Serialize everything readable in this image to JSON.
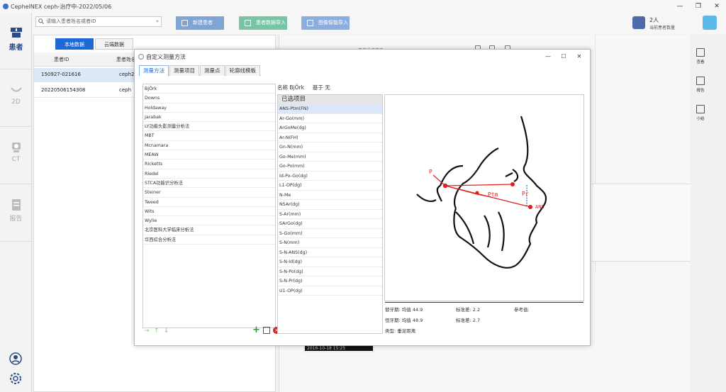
{
  "window": {
    "title": "CephelNEX  ceph-治疗中-2022/05/06",
    "minimize": "—",
    "restore": "❐",
    "close": "✕"
  },
  "nav": {
    "items": [
      {
        "label": "患者",
        "icon": "patient-icon"
      },
      {
        "label": "2D",
        "icon": "smile-icon"
      },
      {
        "label": "CT",
        "icon": "ct-icon"
      },
      {
        "label": "报告",
        "icon": "report-icon"
      }
    ],
    "bottom": [
      {
        "icon": "user-icon"
      },
      {
        "icon": "settings-icon"
      }
    ]
  },
  "toolbar": {
    "search_placeholder": "请输入患者姓名或者ID",
    "new_patient": "新建患者",
    "import_data": "患者数据导入",
    "smart_import": "图像智能导入",
    "patients_count": "2人",
    "patients_caption": "当前患者数量"
  },
  "left_panel": {
    "tabs": [
      "本地数据",
      "云端数据"
    ],
    "headers": [
      "患者ID",
      "患者姓名"
    ],
    "rows": [
      {
        "id": "150927-021616",
        "name": "ceph2"
      },
      {
        "id": "20220506154308",
        "name": "ceph"
      }
    ]
  },
  "right_panel": {
    "hint": "患者治疗信息",
    "side_tools": [
      "查看",
      "报告",
      "小结"
    ],
    "strip_text": "2016-10-18 15:25"
  },
  "dialog": {
    "title": "自定义测量方法",
    "controls": {
      "min": "—",
      "max": "☐",
      "close": "✕"
    },
    "tabs": [
      "测量方法",
      "测量项目",
      "测量点",
      "轮廓线模板"
    ],
    "methods": [
      "BjÖrk",
      "Downs",
      "Holdaway",
      "Jarabak",
      "LY功能头影测量分析法",
      "MBT",
      "Mcnamara",
      "MEAW",
      "Ricketts",
      "Riedel",
      "STCA功能识分析法",
      "Steiner",
      "Tweed",
      "Wits",
      "Wylie",
      "北京医科大学临床分析法",
      "华西综合分析法"
    ],
    "name_label": "名称",
    "name_value": "BjÖrk",
    "base_label": "基于",
    "base_value": "无",
    "selected_header": "已选项目",
    "selected_items": [
      "ANS-Ptm(FN)",
      "Ar-Go(mm)",
      "ArGoMe(dg)",
      "Ar-N(FH)",
      "Gn-N(mm)",
      "Go-Me(mm)",
      "Go-Po(mm)",
      "Id-Po-Go(dg)",
      "L1-OP(dg)",
      "N-Me",
      "NSAr(dg)",
      "S-Ar(mm)",
      "SArGo(dg)",
      "S-Go(mm)",
      "S-N(mm)",
      "S-N-ANS(dg)",
      "S-N-Id(dg)",
      "S-N-Po(dg)",
      "S-N-Pr(dg)",
      "U1-OP(dg)"
    ],
    "diagram_labels": {
      "p": "P",
      "ptm": "Ptm",
      "pr": "Pr",
      "ans": "ANS"
    },
    "info": {
      "row1_a": "替牙期: 均值 44.9",
      "row1_b": "标准差: 2.2",
      "row1_c": "参考值:",
      "row2_a": "恒牙期: 均值 48.9",
      "row2_b": "标准差: 2.7",
      "row3": "类型: 垂足距离"
    }
  },
  "colors": {
    "accent": "#1d6ad7",
    "nav_active": "#2b4a86",
    "green": "#78c5a6",
    "red": "#e02020"
  }
}
